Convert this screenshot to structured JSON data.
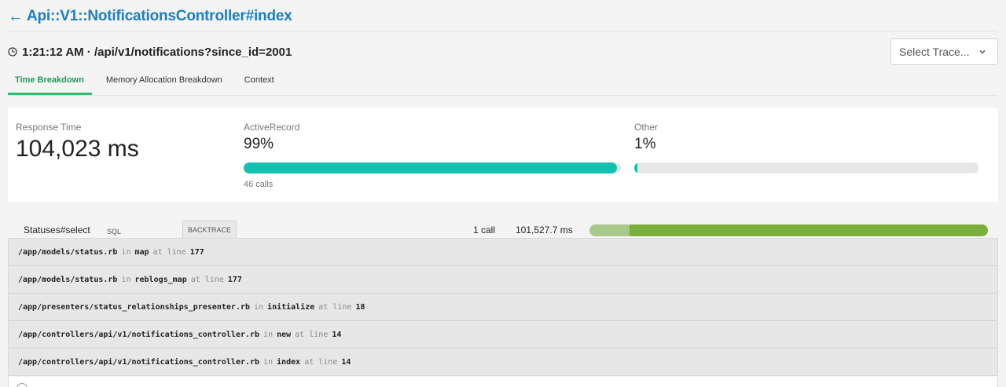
{
  "header": {
    "back_arrow": "←",
    "title": "Api::V1::NotificationsController#index"
  },
  "trace": {
    "heading": "1:21:12 AM · /api/v1/notifications?since_id=2001",
    "select_placeholder": "Select Trace..."
  },
  "tabs": [
    {
      "label": "Time Breakdown",
      "active": true
    },
    {
      "label": "Memory Allocation Breakdown",
      "active": false
    },
    {
      "label": "Context",
      "active": false
    }
  ],
  "summary": {
    "response_time_label": "Response Time",
    "response_time_value": "104,023 ms",
    "active_record": {
      "label": "ActiveRecord",
      "percent_text": "99%",
      "percent": 99,
      "calls_text": "46 calls"
    },
    "other": {
      "label": "Other",
      "percent_text": "1%",
      "percent": 1
    }
  },
  "statuses": {
    "name": "Statuses#select",
    "tab_sql": "SQL",
    "tab_backtrace": "BACKTRACE",
    "calls": "1 call",
    "ms": "101,527.7 ms",
    "bar_fraction": 0.9
  },
  "backtrace": [
    {
      "path": "/app/models/status.rb",
      "in_kw": "in",
      "method": "map",
      "at_kw": "at line",
      "line": "177"
    },
    {
      "path": "/app/models/status.rb",
      "in_kw": "in",
      "method": "reblogs_map",
      "at_kw": "at line",
      "line": "177"
    },
    {
      "path": "/app/presenters/status_relationships_presenter.rb",
      "in_kw": "in",
      "method": "initialize",
      "at_kw": "at line",
      "line": "18"
    },
    {
      "path": "/app/controllers/api/v1/notifications_controller.rb",
      "in_kw": "in",
      "method": "new",
      "at_kw": "at line",
      "line": "14"
    },
    {
      "path": "/app/controllers/api/v1/notifications_controller.rb",
      "in_kw": "in",
      "method": "index",
      "at_kw": "at line",
      "line": "14"
    }
  ],
  "colors": {
    "link_blue": "#1a7fc2",
    "tab_active_green": "#2ebd6b",
    "teal_bar": "#12c0b0",
    "green_bar": "#7aaf3a"
  }
}
